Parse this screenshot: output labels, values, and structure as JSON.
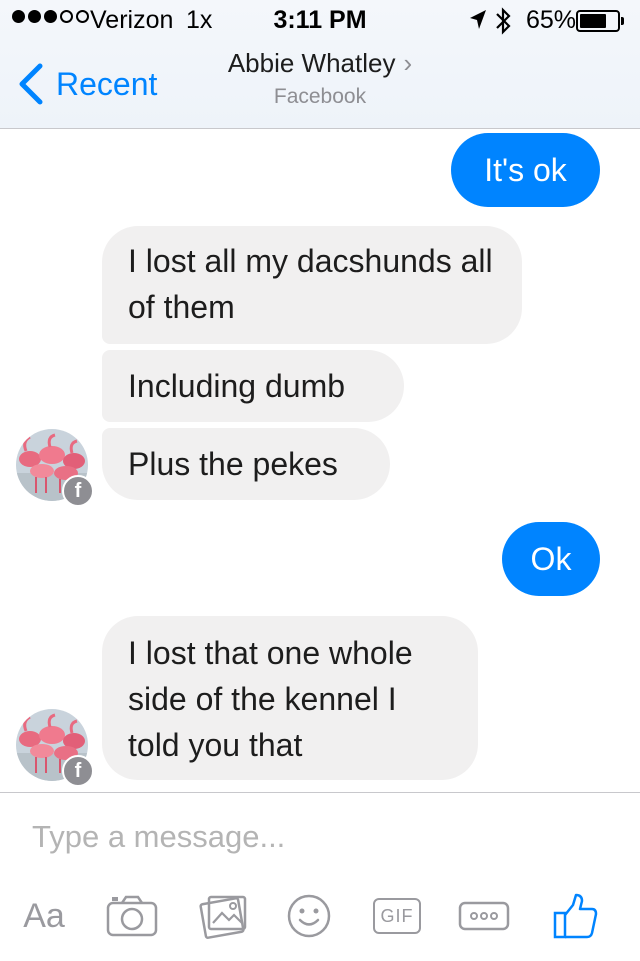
{
  "status_bar": {
    "carrier": "Verizon",
    "network": "1x",
    "time": "3:11 PM",
    "battery": "65%",
    "battery_level": 0.65
  },
  "header": {
    "back_label": "Recent",
    "contact_name": "Abbie Whatley",
    "name_chevron": "›",
    "subtitle": "Facebook"
  },
  "messages": [
    {
      "from": "me",
      "text": "It's ok"
    },
    {
      "from": "them",
      "text": "I lost all my dacshunds all of them"
    },
    {
      "from": "them",
      "text": "Including dumb"
    },
    {
      "from": "them",
      "text": "Plus the pekes"
    },
    {
      "from": "me",
      "text": "Ok"
    },
    {
      "from": "them",
      "text": "I lost that one whole side of the kennel I told you that"
    }
  ],
  "composer": {
    "placeholder": "Type a message...",
    "tools": [
      "text-format",
      "camera",
      "photo",
      "emoji",
      "gif",
      "more",
      "like"
    ],
    "text_format_label": "Aa",
    "gif_label": "GIF",
    "accent_color": "#0084ff"
  },
  "colors": {
    "outgoing_bubble": "#0084ff",
    "incoming_bubble": "#f1f0f0",
    "accent": "#0084ff"
  }
}
